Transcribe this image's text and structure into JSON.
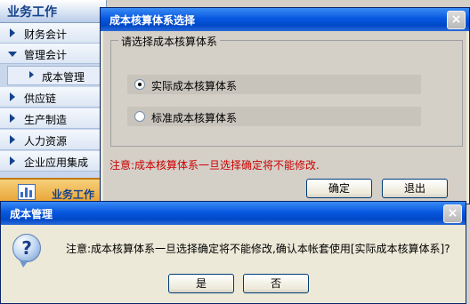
{
  "nav": {
    "header": "业务工作",
    "items": [
      "财务会计",
      "管理会计",
      "供应链",
      "生产制造",
      "人力资源",
      "企业应用集成"
    ],
    "sub_item": "成本管理",
    "bottom": "业务工作"
  },
  "cost_dialog": {
    "title": "成本核算体系选择",
    "close": "×",
    "group_label": "请选择成本核算体系",
    "options": [
      {
        "label": "实际成本核算体系",
        "selected": true
      },
      {
        "label": "标准成本核算体系",
        "selected": false
      }
    ],
    "notice": "注意:成本核算体系一旦选择确定将不能修改.",
    "ok_label": "确定",
    "exit_label": "退出"
  },
  "msg_box": {
    "title": "成本管理",
    "close": "×",
    "icon": "question-icon",
    "icon_glyph": "?",
    "text": "注意:成本核算体系一旦选择确定将不能修改,确认本帐套使用[实际成本核算体系]?",
    "yes_label": "是",
    "no_label": "否"
  },
  "colors": {
    "titlebar": "#0858e0",
    "notice": "#cc0000",
    "nav_text": "#15428b"
  }
}
